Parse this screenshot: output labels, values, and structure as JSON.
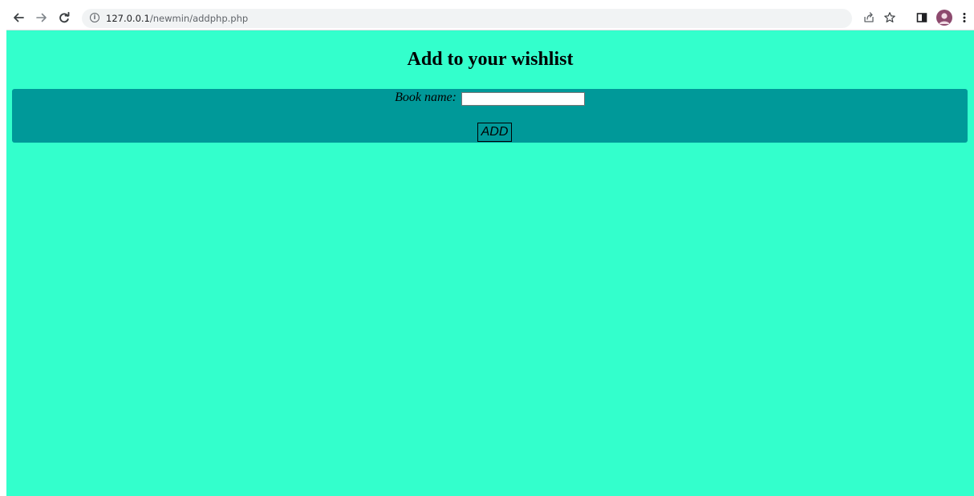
{
  "browser": {
    "url_host": "127.0.0.1",
    "url_path": "/newmin/addphp.php",
    "icons": {
      "back": "back-arrow-icon",
      "forward": "forward-arrow-icon",
      "reload": "reload-icon",
      "site_info": "info-icon",
      "share": "share-icon",
      "bookmark": "star-icon",
      "side_panel": "side-panel-icon",
      "profile": "avatar",
      "menu": "kebab-menu-icon"
    }
  },
  "page": {
    "background_color": "#33ffcc",
    "heading": "Add to your wishlist",
    "form": {
      "panel_color": "#009999",
      "book_name_label": "Book name:",
      "book_name_value": "",
      "book_name_placeholder": "",
      "submit_label": "ADD"
    }
  }
}
